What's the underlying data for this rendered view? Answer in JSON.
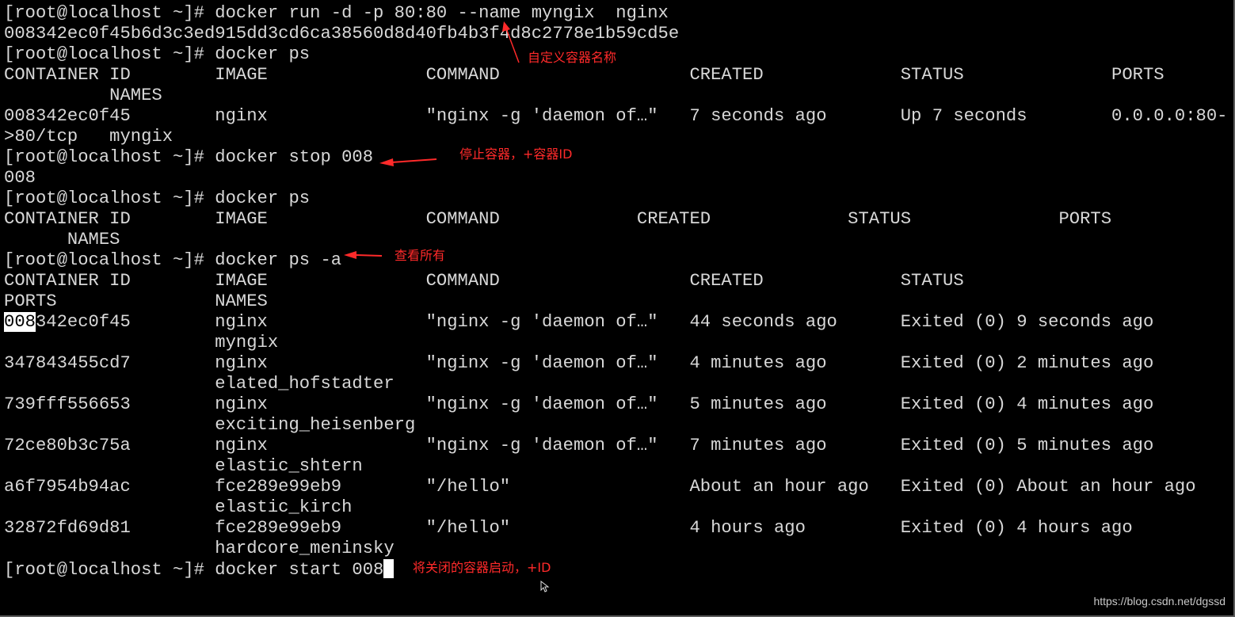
{
  "terminal": {
    "lines": [
      "[root@localhost ~]# docker run -d -p 80:80 --name myngix  nginx",
      "008342ec0f45b6d3c3ed915dd3cd6ca38560d8d40fb4b3f4d8c2778e1b59cd5e",
      "[root@localhost ~]# docker ps",
      "CONTAINER ID        IMAGE               COMMAND                  CREATED             STATUS              PORTS",
      "          NAMES",
      "008342ec0f45        nginx               \"nginx -g 'daemon of…\"   7 seconds ago       Up 7 seconds        0.0.0.0:80-",
      ">80/tcp   myngix",
      "[root@localhost ~]# docker stop 008",
      "008",
      "[root@localhost ~]# docker ps",
      "CONTAINER ID        IMAGE               COMMAND             CREATED             STATUS              PORTS",
      "      NAMES",
      "[root@localhost ~]# docker ps -a",
      "CONTAINER ID        IMAGE               COMMAND                  CREATED             STATUS",
      "PORTS               NAMES",
      "",
      "                    myngix",
      "347843455cd7        nginx               \"nginx -g 'daemon of…\"   4 minutes ago       Exited (0) 2 minutes ago",
      "                    elated_hofstadter",
      "739fff556653        nginx               \"nginx -g 'daemon of…\"   5 minutes ago       Exited (0) 4 minutes ago",
      "                    exciting_heisenberg",
      "72ce80b3c75a        nginx               \"nginx -g 'daemon of…\"   7 minutes ago       Exited (0) 5 minutes ago",
      "                    elastic_shtern",
      "a6f7954b94ac        fce289e99eb9        \"/hello\"                 About an hour ago   Exited (0) About an hour ago",
      "                    elastic_kirch",
      "32872fd69d81        fce289e99eb9        \"/hello\"                 4 hours ago         Exited (0) 4 hours ago",
      "                    hardcore_meninsky",
      ""
    ],
    "highlighted_row": {
      "selected_text": "008",
      "rest": "342ec0f45        nginx               \"nginx -g 'daemon of…\"   44 seconds ago      Exited (0) 9 seconds ago"
    },
    "current_command": "[root@localhost ~]# docker start 008"
  },
  "annotations": {
    "custom_name": "自定义容器名称",
    "stop_container": "停止容器，+容器ID",
    "view_all": "查看所有",
    "start_closed": "将关闭的容器启动，+ID"
  },
  "watermark": "https://blog.csdn.net/dgssd",
  "colors": {
    "background": "#000000",
    "terminal_text": "#d8d8d8",
    "annotation": "#ff2a2a",
    "cursor": "#ffffff"
  },
  "icons": {
    "arrow": "red-arrow-icon",
    "pointer": "mouse-pointer-icon"
  }
}
